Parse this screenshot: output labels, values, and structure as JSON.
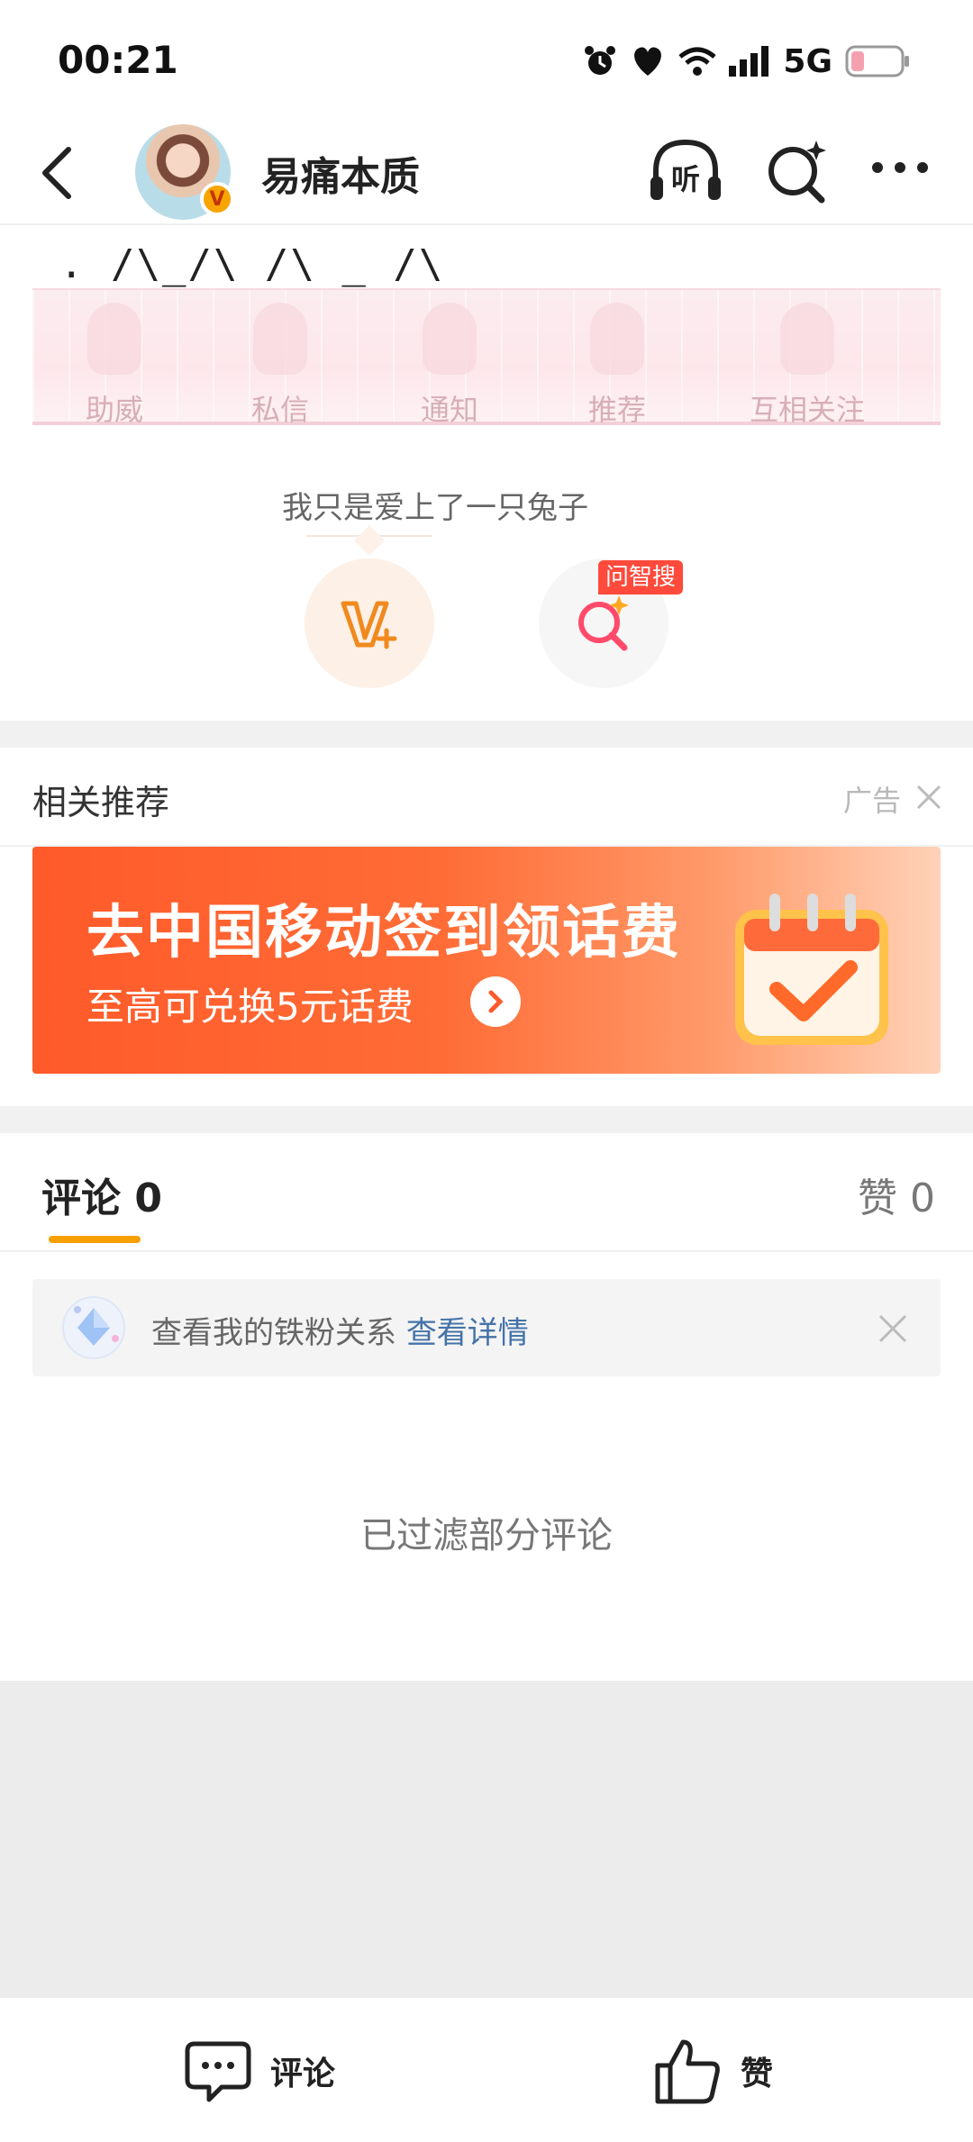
{
  "status_bar": {
    "time": "00:21",
    "network": "5G",
    "icons": [
      "alarm-icon",
      "heart-icon",
      "wifi-icon",
      "signal-icon",
      "battery-icon"
    ]
  },
  "header": {
    "back_icon": "chevron-left-icon",
    "username": "易痛本质",
    "verified_badge": "V",
    "listen_label": "听",
    "search_icon": "ai-search-icon",
    "more_icon": "more-dots-icon"
  },
  "post": {
    "text": ". /\\_/\\  /\\ _ /\\",
    "banner_items": [
      "助威",
      "私信",
      "通知",
      "推荐",
      "互相关注"
    ],
    "caption": "我只是爱上了一只兔子",
    "smart_search_tag": "问智搜"
  },
  "recommend": {
    "title": "相关推荐",
    "ad_label": "广告",
    "ad_headline": "去中国移动签到领话费",
    "ad_subline": "至高可兑换5元话费"
  },
  "comments": {
    "tab_comments": "评论 0",
    "tab_likes": "赞 0",
    "fans_text": "查看我的铁粉关系",
    "fans_link": "查看详情",
    "filtered_note": "已过滤部分评论"
  },
  "bottom_bar": {
    "comment_label": "评论",
    "like_label": "赞"
  },
  "colors": {
    "accent_orange": "#f5a000",
    "ad_orange": "#ff5a2a",
    "link_blue": "#4473a8",
    "tag_red": "#ff4a3c"
  }
}
